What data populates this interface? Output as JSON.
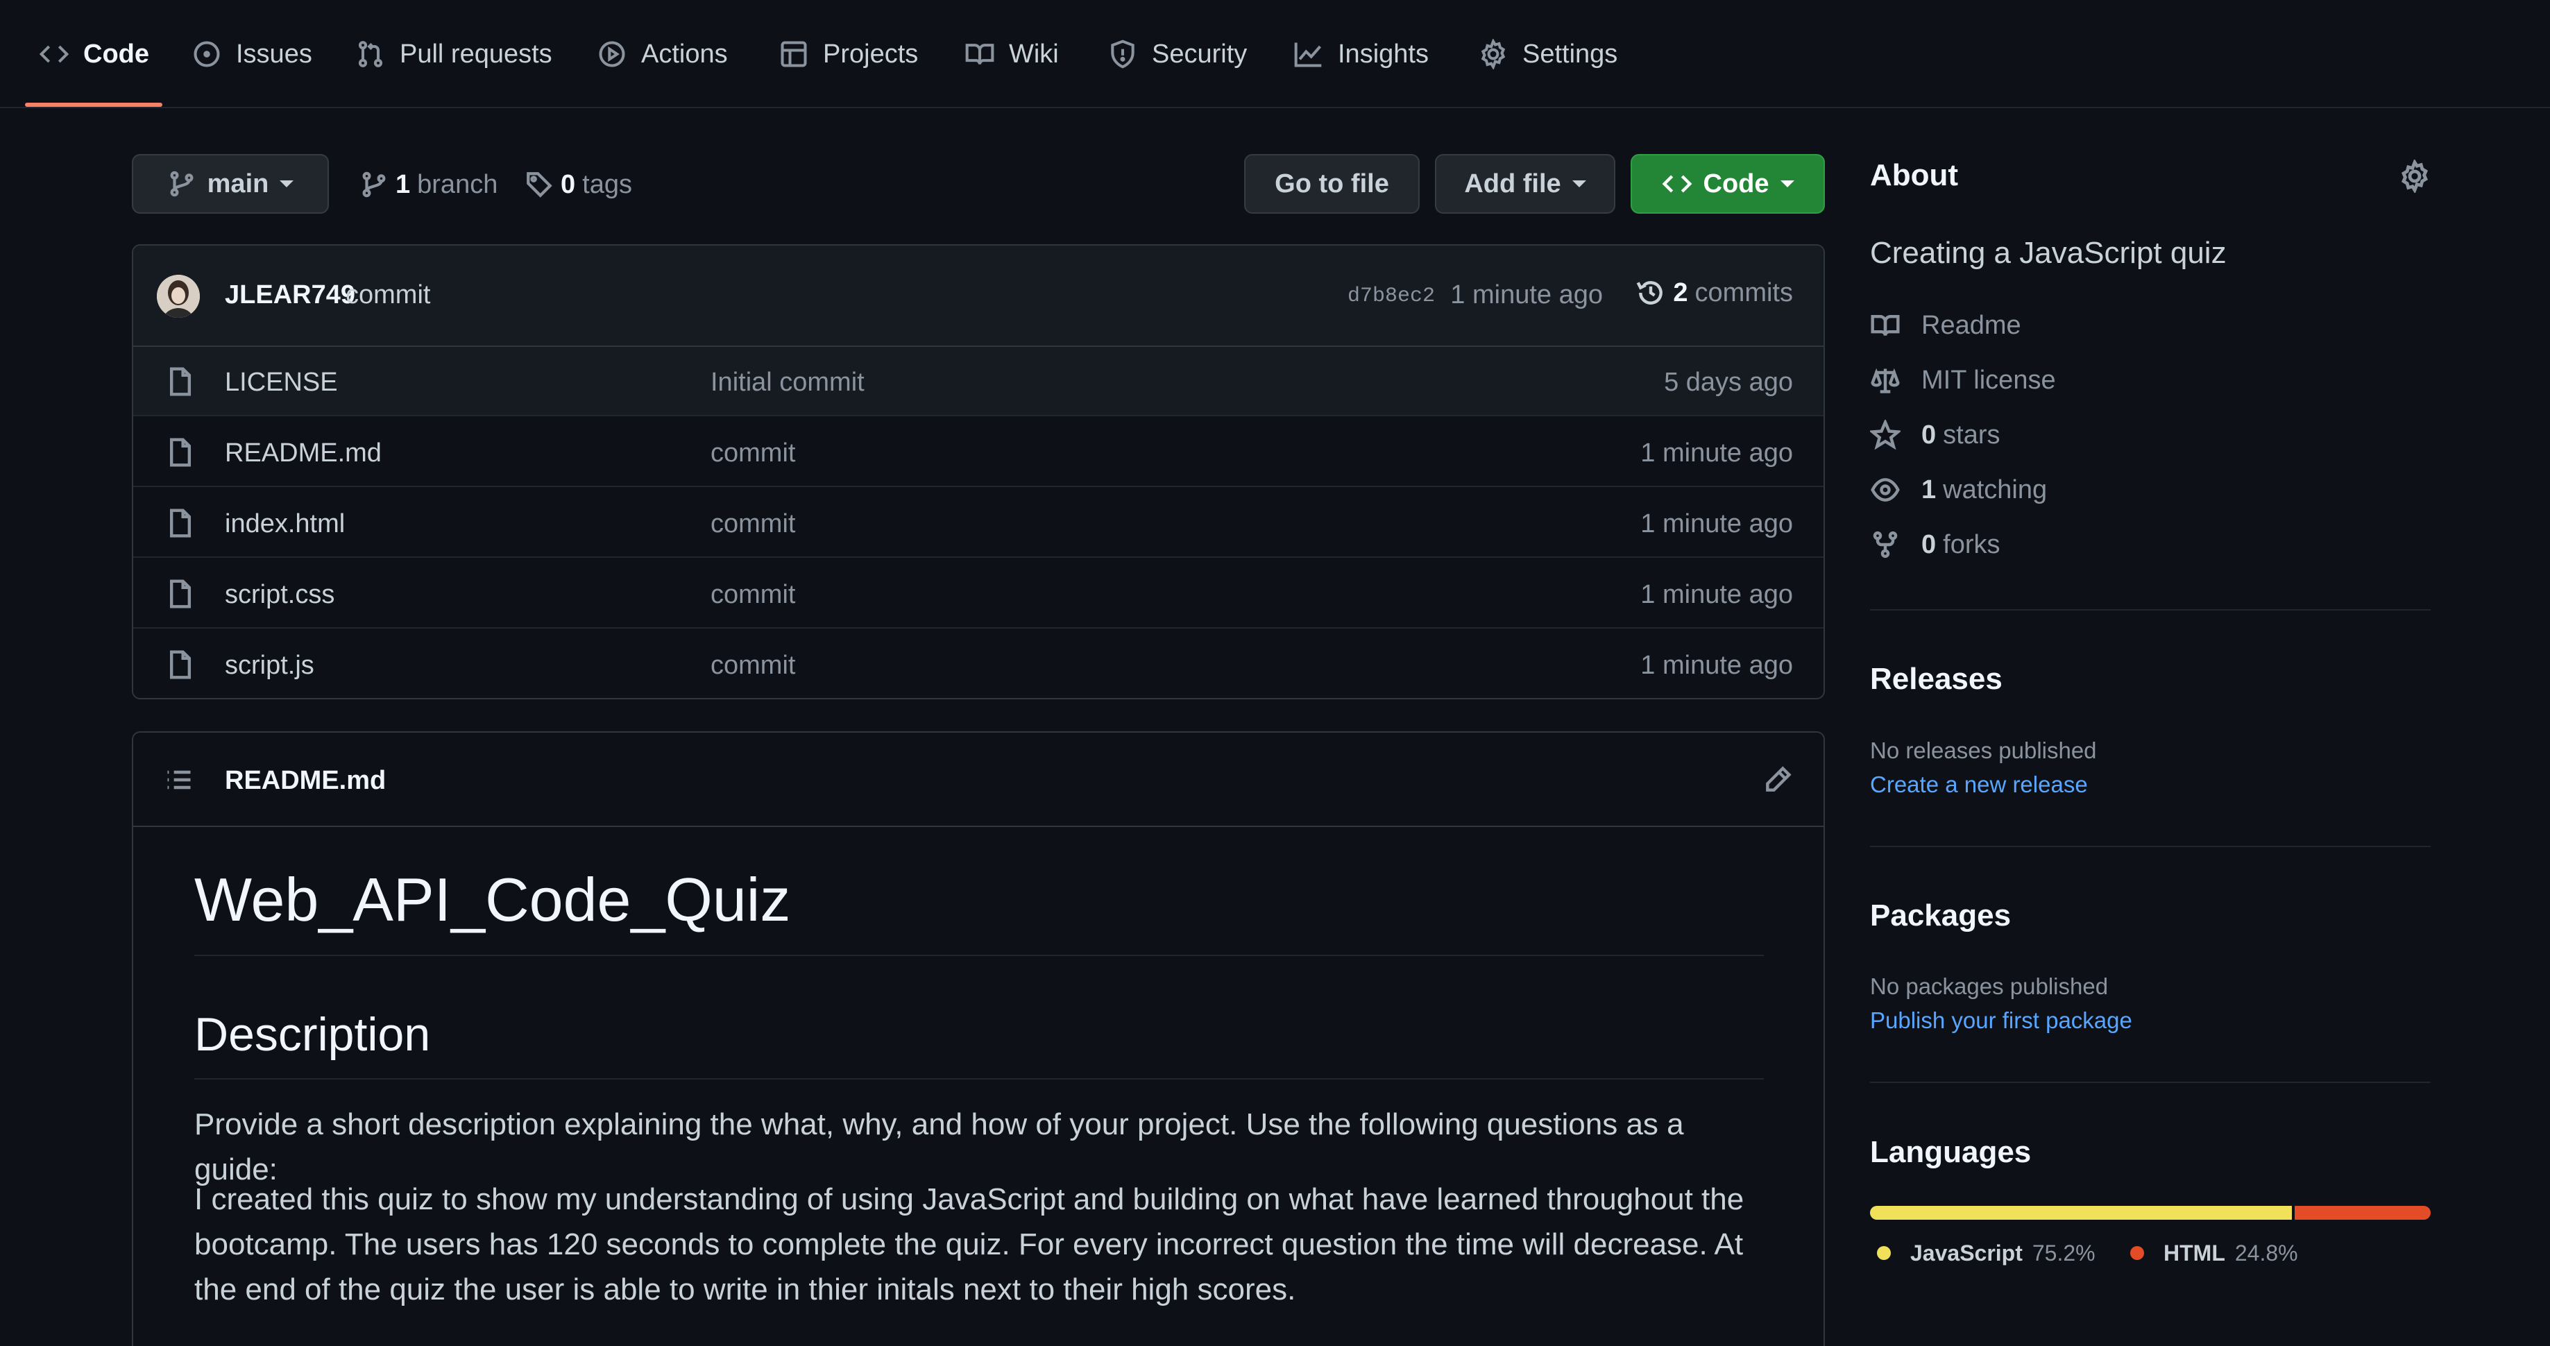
{
  "nav": {
    "tabs": [
      {
        "label": "Code",
        "icon": "code-icon",
        "active": true
      },
      {
        "label": "Issues",
        "icon": "issue-opened-icon"
      },
      {
        "label": "Pull requests",
        "icon": "git-pull-request-icon"
      },
      {
        "label": "Actions",
        "icon": "play-icon"
      },
      {
        "label": "Projects",
        "icon": "table-icon"
      },
      {
        "label": "Wiki",
        "icon": "book-icon"
      },
      {
        "label": "Security",
        "icon": "shield-icon"
      },
      {
        "label": "Insights",
        "icon": "graph-icon"
      },
      {
        "label": "Settings",
        "icon": "gear-icon"
      }
    ],
    "underline_color": "#f78166"
  },
  "repo_toolbar": {
    "branch_button": "main",
    "branch_count": "1",
    "branch_label": "branch",
    "tag_count": "0",
    "tag_label": "tags",
    "go_to_file": "Go to file",
    "add_file": "Add file",
    "code_button": "Code"
  },
  "latest_commit": {
    "author": "JLEAR749",
    "message": "commit",
    "sha": "d7b8ec2",
    "time": "1 minute ago",
    "commit_count": "2",
    "commit_label": "commits"
  },
  "files": [
    {
      "name": "LICENSE",
      "message": "Initial commit",
      "time": "5 days ago"
    },
    {
      "name": "README.md",
      "message": "commit",
      "time": "1 minute ago"
    },
    {
      "name": "index.html",
      "message": "commit",
      "time": "1 minute ago"
    },
    {
      "name": "script.css",
      "message": "commit",
      "time": "1 minute ago"
    },
    {
      "name": "script.js",
      "message": "commit",
      "time": "1 minute ago"
    }
  ],
  "readme": {
    "filename": "README.md",
    "title": "Web_API_Code_Quiz",
    "section_heading": "Description",
    "paragraph_1": "Provide a short description explaining the what, why, and how of your project. Use the following questions as a guide:",
    "paragraph_2": "I created this quiz to show my understanding of using JavaScript and building on what have learned throughout the bootcamp. The users has 120 seconds to complete the quiz. For every incorrect question the time will decrease. At the end of the quiz the user is able to write in thier initals next to their high scores."
  },
  "about": {
    "heading": "About",
    "description": "Creating a JavaScript quiz",
    "items": [
      {
        "icon": "book-icon",
        "count": "",
        "label": "Readme"
      },
      {
        "icon": "law-icon",
        "count": "",
        "label": "MIT license"
      },
      {
        "icon": "star-icon",
        "count": "0",
        "label": "stars"
      },
      {
        "icon": "eye-icon",
        "count": "1",
        "label": "watching"
      },
      {
        "icon": "repo-forked-icon",
        "count": "0",
        "label": "forks"
      }
    ]
  },
  "releases": {
    "heading": "Releases",
    "empty_text": "No releases published",
    "link": "Create a new release"
  },
  "packages": {
    "heading": "Packages",
    "empty_text": "No packages published",
    "link": "Publish your first package"
  },
  "languages": {
    "heading": "Languages",
    "items": [
      {
        "name": "JavaScript",
        "percent": "75.2%",
        "value": 75.2,
        "color": "#f1e05a"
      },
      {
        "name": "HTML",
        "percent": "24.8%",
        "value": 24.8,
        "color": "#e34c26"
      }
    ]
  },
  "colors": {
    "background": "#0d1117",
    "accent_green": "#238636",
    "link_blue": "#58a6ff"
  }
}
